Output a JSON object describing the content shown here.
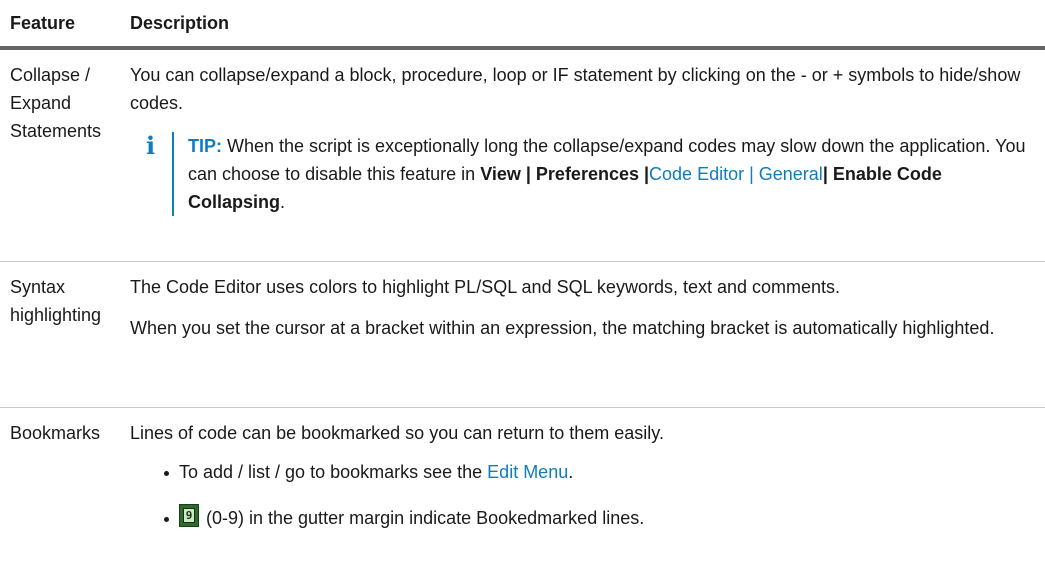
{
  "header": {
    "feature": "Feature",
    "description": "Description"
  },
  "rows": {
    "collapse": {
      "feature": "Collapse / Expand Statements",
      "text": "You can collapse/expand a block, procedure, loop or IF statement by clicking on the - or + symbols to hide/show codes.",
      "tip": {
        "icon": "info-icon",
        "label": "TIP:",
        "text": " When the script is exceptionally long the collapse/expand codes may slow down the application. You can choose to disable this feature in ",
        "bold1": "View | Preferences |",
        "link": "Code Editor | General",
        "bold2": "| Enable Code Collapsing",
        "end": "."
      }
    },
    "syntax": {
      "feature": "Syntax highlighting",
      "p1": "The Code Editor uses colors to highlight PL/SQL and SQL keywords, text and comments.",
      "p2": "When you set the cursor at a bracket within an expression, the matching bracket is automatically highlighted."
    },
    "bookmarks": {
      "feature": "Bookmarks",
      "text": "Lines of code can be bookmarked so you can return to them easily.",
      "item1_pre": "To add / list / go to bookmarks see the ",
      "item1_link": "Edit Menu",
      "item1_post": ".",
      "item2_icon": "bookmark-gutter-icon",
      "item2_text": " (0-9) in the gutter margin indicate Bookedmarked lines."
    }
  },
  "colors": {
    "link": "#0e7dbf",
    "header_rule": "#666666"
  }
}
